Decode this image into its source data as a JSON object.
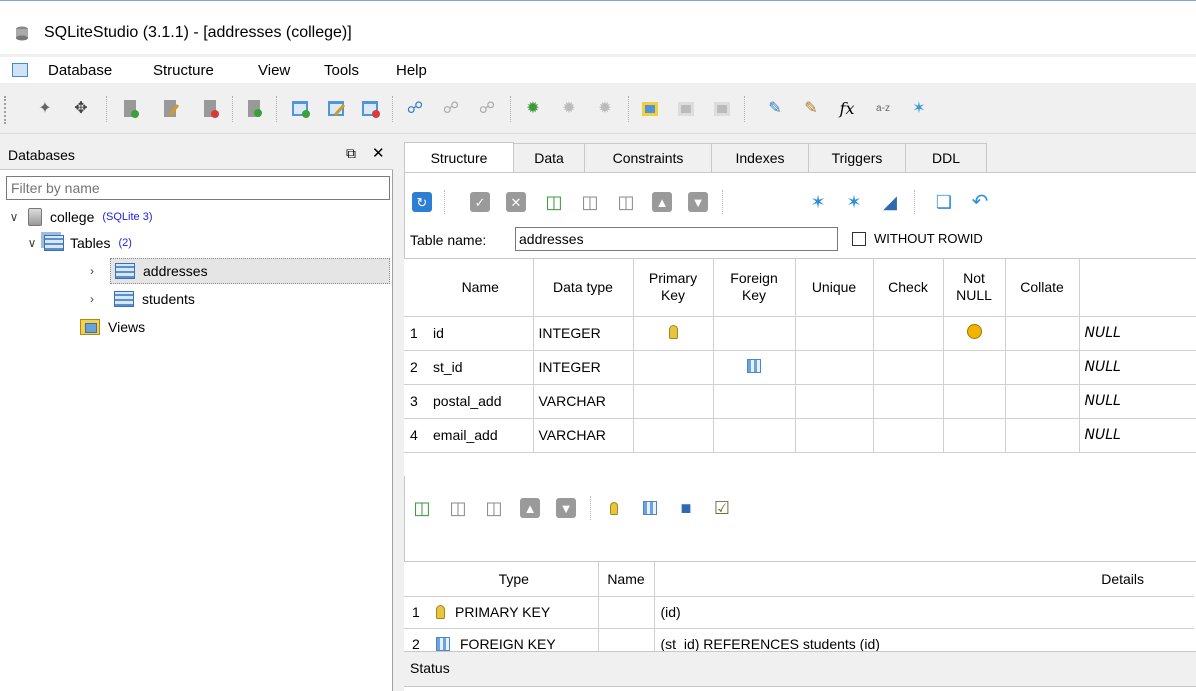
{
  "window": {
    "title": "SQLiteStudio (3.1.1) - [addresses (college)]"
  },
  "menubar": {
    "items": [
      "Database",
      "Structure",
      "View",
      "Tools",
      "Help"
    ]
  },
  "dbpanel": {
    "title": "Databases",
    "filter_placeholder": "Filter by name",
    "tree": {
      "database": {
        "name": "college",
        "badge": "(SQLite 3)"
      },
      "tables": {
        "label": "Tables",
        "badge": "(2)"
      },
      "items": [
        "addresses",
        "students"
      ],
      "views": "Views"
    }
  },
  "tabs": [
    "Structure",
    "Data",
    "Constraints",
    "Indexes",
    "Triggers",
    "DDL"
  ],
  "structure": {
    "table_name_label": "Table name:",
    "table_name": "addresses",
    "without_rowid": "WITHOUT ROWID",
    "columns_header": [
      "Name",
      "Data type",
      "Primary Key",
      "Foreign Key",
      "Unique",
      "Check",
      "Not NULL",
      "Collate",
      ""
    ],
    "columns": [
      {
        "n": "1",
        "name": "id",
        "type": "INTEGER",
        "pk": true,
        "fk": false,
        "notnull": true,
        "default": "NULL"
      },
      {
        "n": "2",
        "name": "st_id",
        "type": "INTEGER",
        "pk": false,
        "fk": true,
        "notnull": false,
        "default": "NULL"
      },
      {
        "n": "3",
        "name": "postal_add",
        "type": "VARCHAR",
        "pk": false,
        "fk": false,
        "notnull": false,
        "default": "NULL"
      },
      {
        "n": "4",
        "name": "email_add",
        "type": "VARCHAR",
        "pk": false,
        "fk": false,
        "notnull": false,
        "default": "NULL"
      }
    ],
    "constraints_header": [
      "Type",
      "Name",
      "Details"
    ],
    "constraints": [
      {
        "n": "1",
        "type": "PRIMARY KEY",
        "icon": "key-icon",
        "name": "",
        "details": "(id)"
      },
      {
        "n": "2",
        "type": "FOREIGN KEY",
        "icon": "foreign-key-icon",
        "name": "",
        "details": "(st_id) REFERENCES students (id)"
      }
    ]
  },
  "status": {
    "title": "Status"
  },
  "colors": {
    "accent": "#2d7fd3",
    "key": "#e8c440",
    "notnull": "#f2b400"
  }
}
